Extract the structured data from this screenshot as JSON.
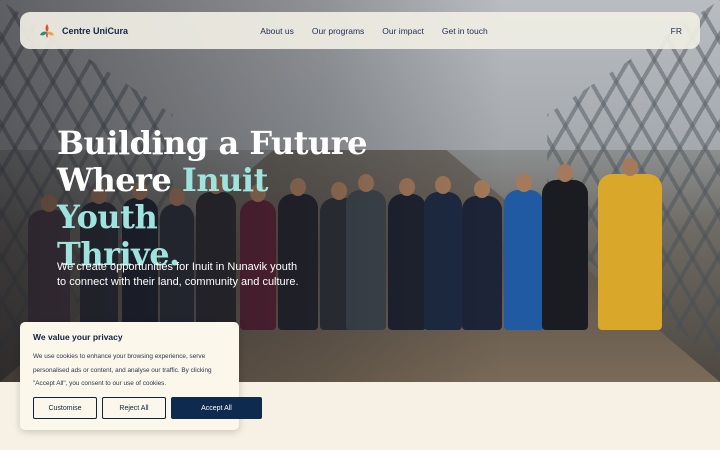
{
  "brand": {
    "name": "Centre UniCura",
    "logo_icon": "unicura-logo-icon"
  },
  "nav": {
    "links": [
      "About us",
      "Our programs",
      "Our impact",
      "Get in touch"
    ],
    "lang": "FR"
  },
  "hero": {
    "headline_line1": "Building a Future",
    "headline_line2_a": "Where ",
    "headline_line2_b": "Inuit Youth",
    "headline_line3": "Thrive.",
    "subtext": "We create opportunities for Inuit in Nunavik youth to connect with their land, community and culture."
  },
  "cookie": {
    "title": "We value your privacy",
    "text": "We use cookies to enhance your browsing experience, serve personalised ads or content, and analyse our traffic. By clicking \"Accept All\", you consent to our use of cookies.",
    "customise": "Customise",
    "reject": "Reject All",
    "accept": "Accept All"
  },
  "colors": {
    "navy": "#0f2a4f",
    "accent_teal": "#9fe3de",
    "cream": "#f6f1e4"
  }
}
